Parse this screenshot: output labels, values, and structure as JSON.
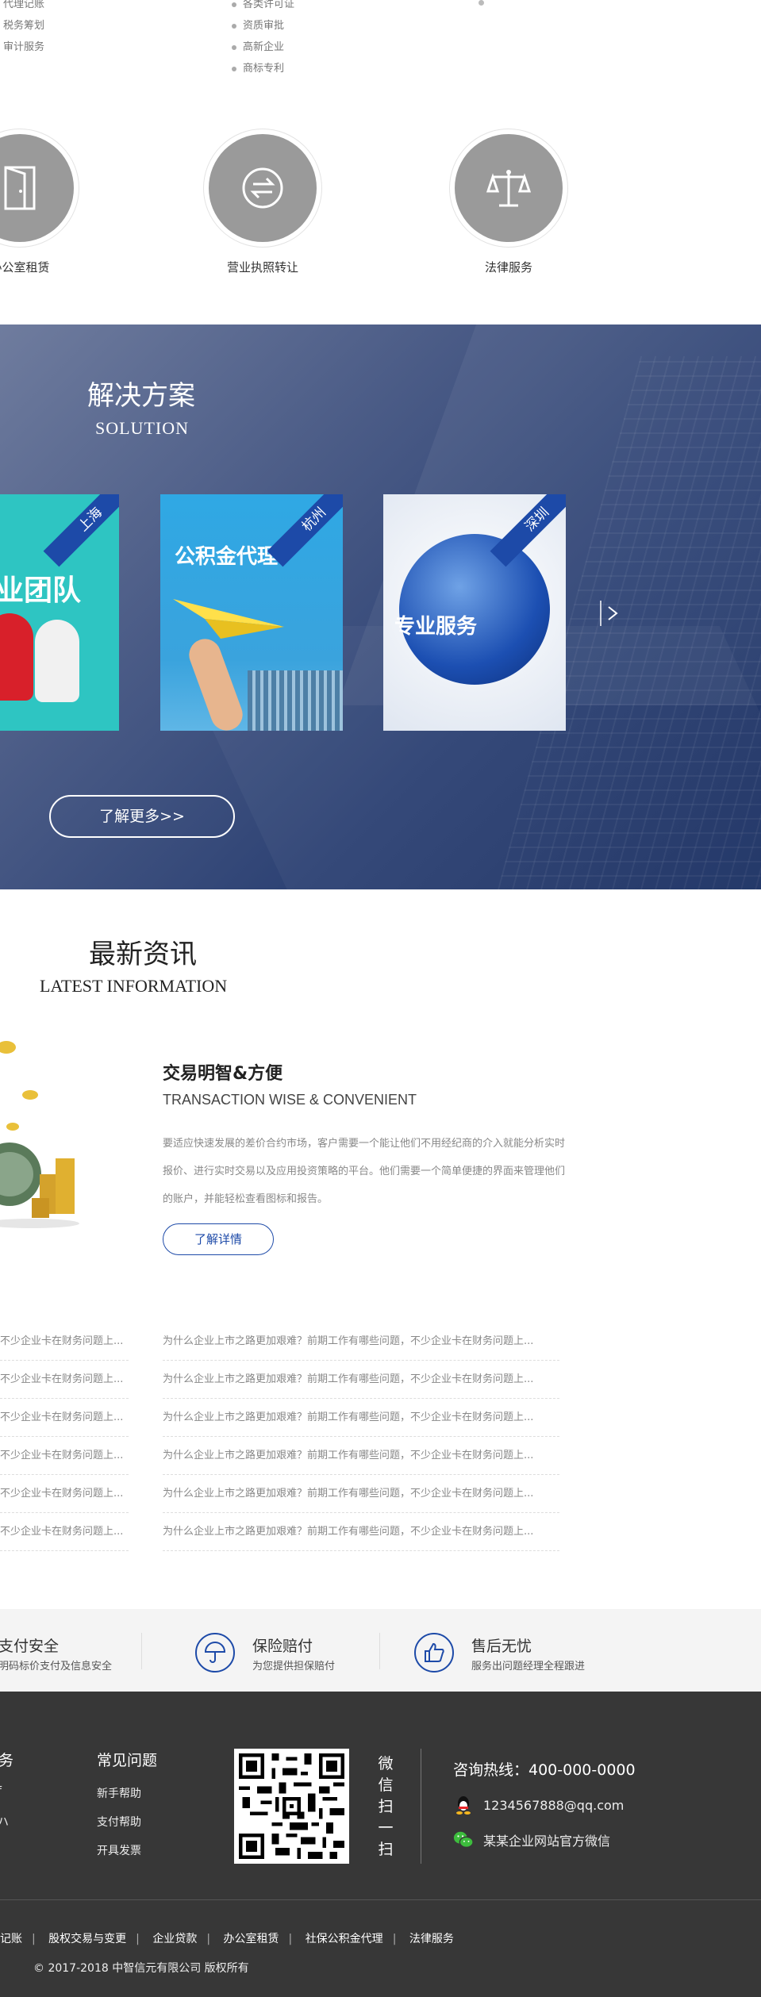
{
  "top_services": {
    "col1": [
      "代理记账",
      "税务筹划",
      "审计服务"
    ],
    "col2": [
      "各类许可证",
      "资质审批",
      "高新企业",
      "商标专利"
    ]
  },
  "circle_services": [
    {
      "label": "办公室租赁",
      "icon": "door-icon"
    },
    {
      "label": "营业执照转让",
      "icon": "exchange-icon"
    },
    {
      "label": "法律服务",
      "icon": "scale-icon"
    }
  ],
  "solution": {
    "title": "解决方案",
    "subtitle": "SOLUTION",
    "cards": [
      {
        "city": "上海",
        "text": "业团队",
        "bg": "#2ec5c2"
      },
      {
        "city": "杭州",
        "text": "公积金代理",
        "bg": "#2fa8e4"
      },
      {
        "city": "深圳",
        "text": "专业服务",
        "bg": "#e8eef6"
      }
    ],
    "more_label": "了解更多>>"
  },
  "news": {
    "title": "最新资讯",
    "subtitle": "LATEST INFORMATION",
    "featured": {
      "title": "交易明智&方便",
      "subtitle": "TRANSACTION WISE & CONVENIENT",
      "desc": "要适应快速发展的差价合约市场，客户需要一个能让他们不用经纪商的介入就能分析实时报价、进行实时交易以及应用投资策略的平台。他们需要一个简单便捷的界面来管理他们的账户，并能轻松查看图标和报告。",
      "button": "了解详情"
    },
    "left_items": [
      "不少企业卡在财务问题上...",
      "不少企业卡在财务问题上...",
      "不少企业卡在财务问题上...",
      "不少企业卡在财务问题上...",
      "不少企业卡在财务问题上...",
      "不少企业卡在财务问题上..."
    ],
    "right_items": [
      "为什么企业上市之路更加艰难？前期工作有哪些问题，不少企业卡在财务问题上...",
      "为什么企业上市之路更加艰难？前期工作有哪些问题，不少企业卡在财务问题上...",
      "为什么企业上市之路更加艰难？前期工作有哪些问题，不少企业卡在财务问题上...",
      "为什么企业上市之路更加艰难？前期工作有哪些问题，不少企业卡在财务问题上...",
      "为什么企业上市之路更加艰难？前期工作有哪些问题，不少企业卡在财务问题上...",
      "为什么企业上市之路更加艰难？前期工作有哪些问题，不少企业卡在财务问题上..."
    ]
  },
  "guarantees": [
    {
      "title": "支付安全",
      "desc": "明码标价支付及信息安全"
    },
    {
      "title": "保险赔付",
      "desc": "为您提供担保赔付"
    },
    {
      "title": "售后无忧",
      "desc": "服务出问题经理全程跟进"
    }
  ],
  "footer": {
    "col1_head": "务",
    "col1_links": [
      "f",
      "ハ",
      "l"
    ],
    "col2_head": "常见问题",
    "col2_links": [
      "新手帮助",
      "支付帮助",
      "开具发票"
    ],
    "wechat_vertical": [
      "微",
      "信",
      "扫",
      "一",
      "扫"
    ],
    "hotline": "咨询热线：400-000-0000",
    "email": "1234567888@qq.com",
    "wechat": "某某企业网站官方微信",
    "bottom_links": [
      "记账",
      "股权交易与变更",
      "企业贷款",
      "办公室租赁",
      "社保公积金代理",
      "法律服务"
    ],
    "copyright": "© 2017-2018 中智信元有限公司 版权所有"
  },
  "colors": {
    "accent": "#1d4aa8",
    "footer_bg": "#373737",
    "guarantee_bg": "#f4f4f4"
  }
}
